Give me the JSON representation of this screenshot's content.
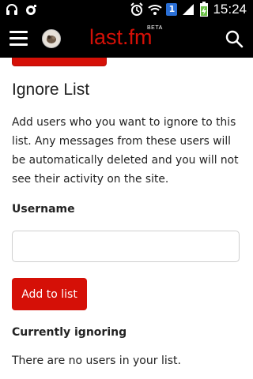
{
  "status_bar": {
    "time": "15:24",
    "badge": "1",
    "icons": [
      "headset-icon",
      "camera-icon",
      "alarm-icon",
      "wifi-icon",
      "signal-icon",
      "battery-charging-icon"
    ]
  },
  "app_bar": {
    "logo": "last.fm",
    "beta": "BETA",
    "menu_icon": "hamburger-menu-icon",
    "search_icon": "search-icon",
    "brand_color": "#d51007"
  },
  "page": {
    "title": "Ignore List",
    "description": "Add users who you want to ignore to this list. Any messages from these users will be automatically deleted and you will not see their activity on the site.",
    "username_label": "Username",
    "username_value": "",
    "username_placeholder": "",
    "add_button": "Add to list",
    "currently_ignoring_label": "Currently ignoring",
    "empty_message": "There are no users in your list."
  }
}
